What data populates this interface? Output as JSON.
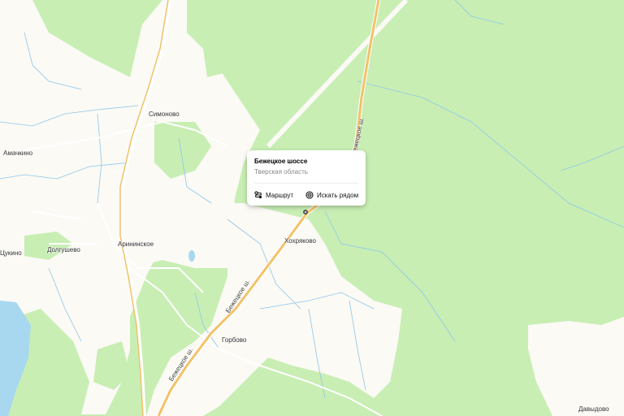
{
  "places": {
    "simonovo": "Симоново",
    "amachkino": "Амачкино",
    "arininskoe": "Арининское",
    "dolgushevo": "Долгушево",
    "tsukino": "Цукино",
    "khokhryakovo": "Хохряково",
    "gorbovo": "Горбово",
    "davydovo": "Давыдово"
  },
  "road_labels": {
    "upper": "Бежецкое ш.",
    "middle": "Бежецкое ш.",
    "lower": "Бежецкое ш."
  },
  "popup": {
    "title": "Бежецкое шоссе",
    "subtitle": "Тверская область",
    "route_label": "Маршрут",
    "nearby_label": "Искать рядом",
    "route_icon": "route-icon",
    "nearby_icon": "search-nearby-icon"
  },
  "colors": {
    "forest": "#c8eeb4",
    "settlement": "#fbfaf5",
    "water": "#a8d8ef",
    "highway": "#f2c268"
  }
}
